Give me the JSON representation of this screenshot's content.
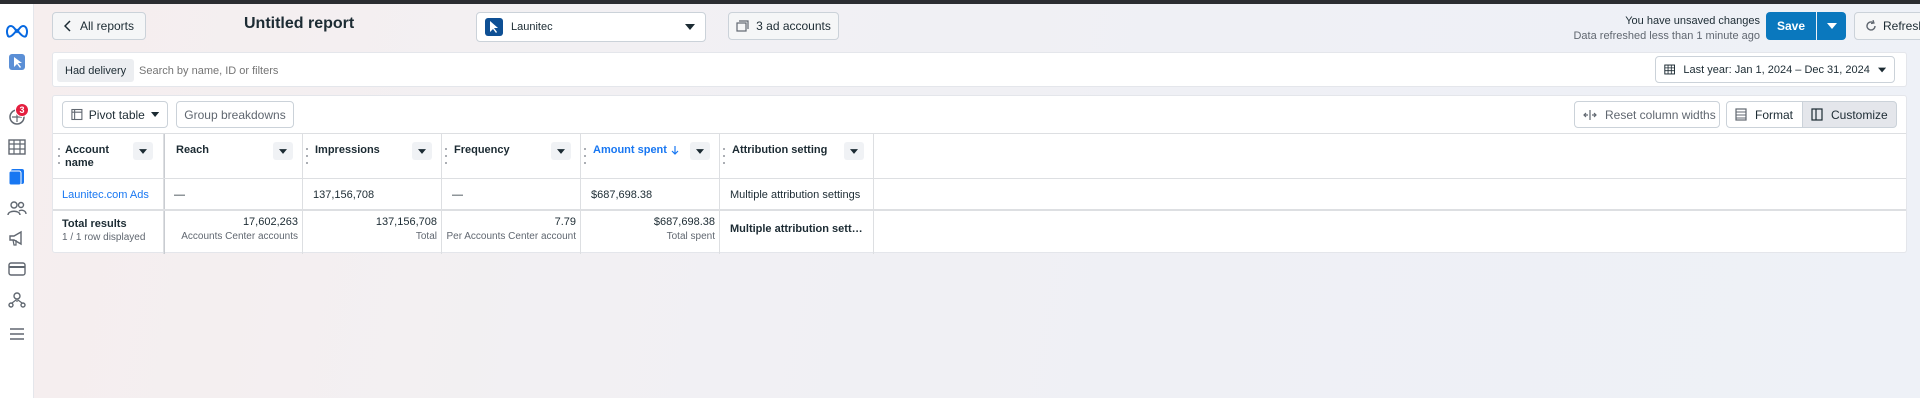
{
  "header": {
    "back_label": "All reports",
    "title": "Untitled report",
    "account_name": "Launitec",
    "ad_accounts_label": "3 ad accounts",
    "unsaved_text": "You have unsaved changes",
    "refreshed_text": "Data refreshed less than 1 minute ago",
    "save_label": "Save",
    "refresh_label": "Refresh"
  },
  "sidebar": {
    "notification_count": "3",
    "items": [
      "meta-logo-icon",
      "app-icon",
      "notifications-icon",
      "table-icon",
      "reports-icon",
      "audience-icon",
      "campaigns-icon",
      "billing-icon",
      "business-icon",
      "menu-icon"
    ]
  },
  "filters": {
    "chip_label": "Had delivery",
    "search_placeholder": "Search by name, ID or filters",
    "date_range_label": "Last year: Jan 1, 2024 – Dec 31, 2024"
  },
  "toolbar": {
    "pivot_label": "Pivot table",
    "group_label": "Group breakdowns",
    "reset_label": "Reset column widths",
    "format_label": "Format",
    "customize_label": "Customize"
  },
  "table": {
    "columns": [
      "Account name",
      "Reach",
      "Impressions",
      "Frequency",
      "Amount spent",
      "Attribution setting"
    ],
    "sorted_column": "Amount spent",
    "rows": [
      {
        "account": "Launitec.com Ads",
        "reach": "—",
        "impressions": "137,156,708",
        "frequency": "—",
        "amount": "$687,698.38",
        "attribution": "Multiple attribution settings"
      }
    ],
    "totals": {
      "label": "Total results",
      "sub": "1 / 1 row displayed",
      "reach": "17,602,263",
      "reach_sub": "Accounts Center accounts",
      "impressions": "137,156,708",
      "impressions_sub": "Total",
      "frequency": "7.79",
      "frequency_sub": "Per Accounts Center account",
      "amount": "$687,698.38",
      "amount_sub": "Total spent",
      "attribution": "Multiple attribution sett…"
    }
  },
  "colors": {
    "accent": "#0a78be",
    "link": "#1877f2",
    "badge": "#e41e3f"
  }
}
